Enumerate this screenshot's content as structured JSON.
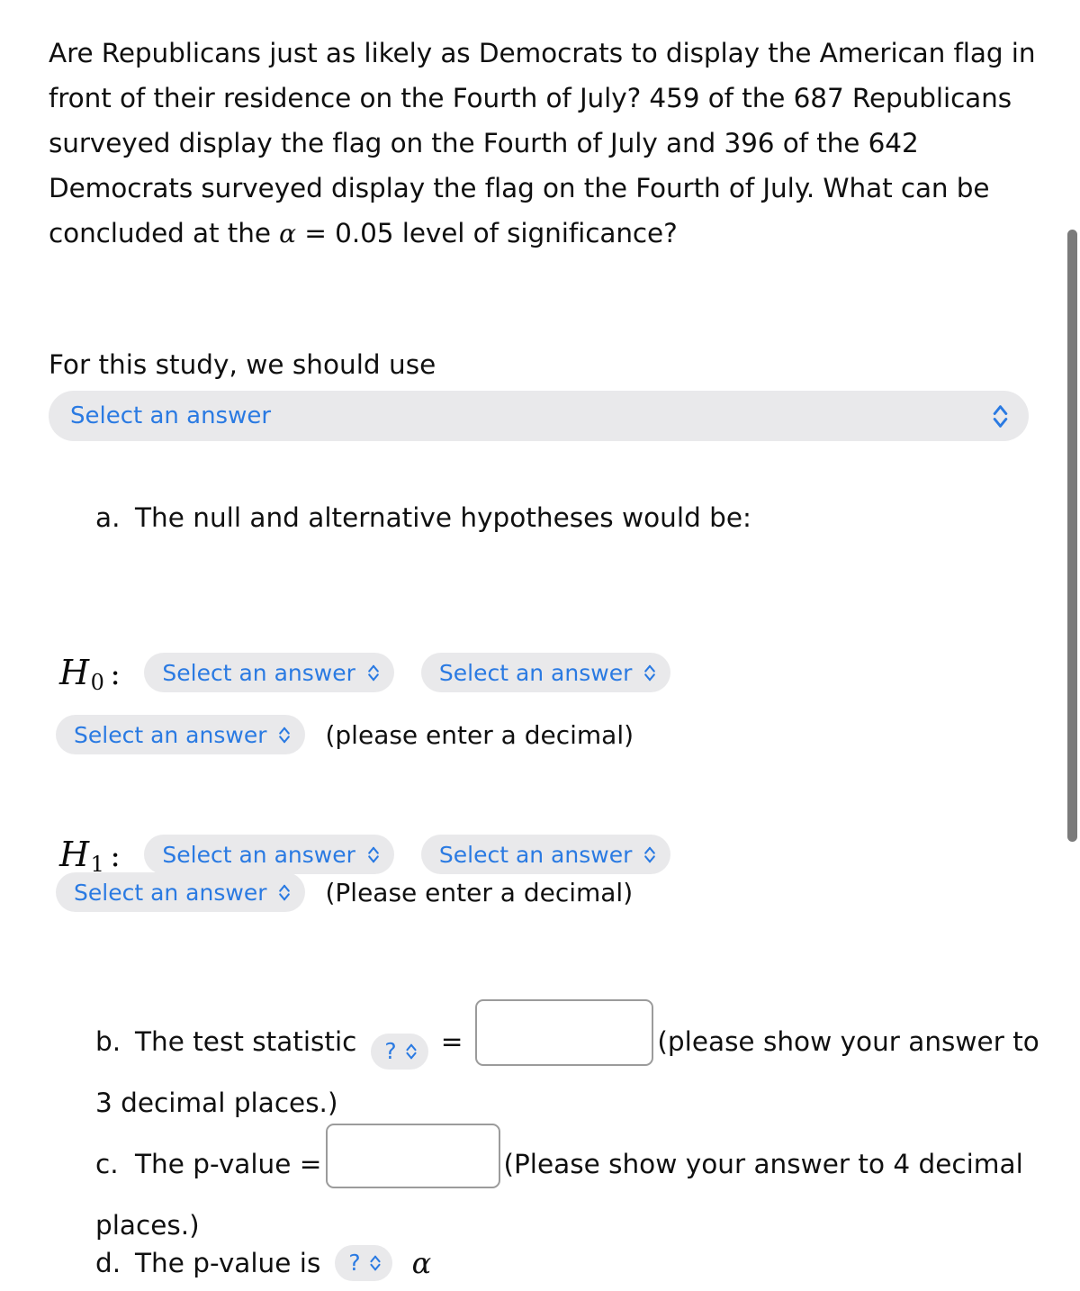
{
  "problem": {
    "text_part1": "Are Republicans just as likely as Democrats to display the American flag in front of their residence on the Fourth of July? 459 of the 687 Republicans surveyed display the flag on the Fourth of July and 396 of the 642 Democrats surveyed display the flag on the Fourth of July. What can be concluded at the ",
    "alpha": "α",
    "text_part2": " = 0.05 level of significance?",
    "republicans_success": 459,
    "republicans_total": 687,
    "democrats_success": 396,
    "democrats_total": 642,
    "alpha_level": "0.05"
  },
  "study": {
    "lead": "For this study, we should use",
    "select_value": "Select an answer"
  },
  "items": {
    "a": {
      "marker": "a.",
      "text": "The null and alternative hypotheses would be:"
    },
    "b": {
      "marker": "b.",
      "text_before": "The test statistic",
      "stat_select": "?",
      "equals": "=",
      "input_value": "",
      "text_after": "(please show your answer to 3 decimal places.)"
    },
    "c": {
      "marker": "c.",
      "text_before": "The p-value =",
      "input_value": "",
      "text_after": "(Please show your answer to 4 decimal places.)"
    },
    "d": {
      "marker": "d.",
      "text_before": "The p-value is",
      "compare_select": "?",
      "alpha": "α"
    }
  },
  "hypotheses": {
    "h0": {
      "label": "H",
      "sub": "0",
      "colon": ":",
      "select1": "Select an answer",
      "select2": "Select an answer",
      "select3": "Select an answer",
      "hint": "(please enter a decimal)"
    },
    "h1": {
      "label": "H",
      "sub": "1",
      "colon": ":",
      "select1": "Select an answer",
      "select2": "Select an answer",
      "select3": "Select an answer",
      "hint": "(Please enter a decimal)"
    }
  },
  "colors": {
    "link_blue": "#2a7ae2",
    "pill_bg": "#e9e9eb",
    "text": "#101010",
    "input_border": "#9b9b9b",
    "scrollbar_thumb": "#7b7b7b"
  },
  "icons": {
    "chevron_up_down": "chevron-up-down-icon"
  }
}
